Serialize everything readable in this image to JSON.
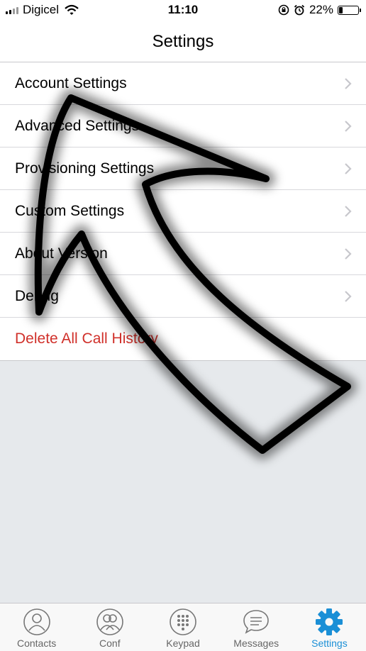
{
  "status_bar": {
    "carrier": "Digicel",
    "time": "11:10",
    "battery_percent": "22%",
    "battery_level": 0.22
  },
  "nav": {
    "title": "Settings"
  },
  "settings_items": [
    {
      "label": "Account Settings"
    },
    {
      "label": "Advanced Settings"
    },
    {
      "label": "Provisioning Settings"
    },
    {
      "label": "Custom Settings"
    },
    {
      "label": "About Version"
    },
    {
      "label": "Debug"
    }
  ],
  "danger_item": {
    "label": "Delete All Call History",
    "color": "#d0302a"
  },
  "tabs": [
    {
      "label": "Contacts",
      "icon": "contacts-icon"
    },
    {
      "label": "Conf",
      "icon": "conference-icon"
    },
    {
      "label": "Keypad",
      "icon": "keypad-icon"
    },
    {
      "label": "Messages",
      "icon": "messages-icon"
    },
    {
      "label": "Settings",
      "icon": "gear-icon",
      "active": true
    }
  ],
  "colors": {
    "accent": "#1a8fd6",
    "background": "#e6e9ec"
  }
}
